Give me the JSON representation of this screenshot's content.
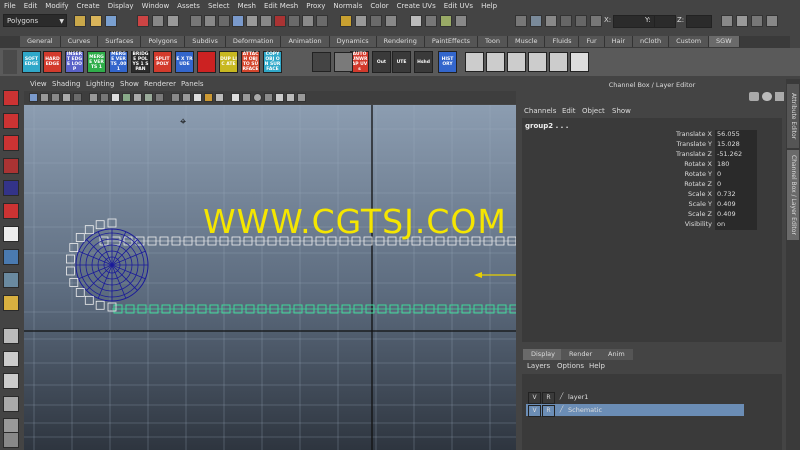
{
  "menu": [
    "File",
    "Edit",
    "Modify",
    "Create",
    "Display",
    "Window",
    "Assets",
    "Select",
    "Mesh",
    "Edit Mesh",
    "Proxy",
    "Normals",
    "Color",
    "Create UVs",
    "Edit UVs",
    "Help"
  ],
  "status": {
    "mode": "Polygons",
    "x_label": "X:",
    "y_label": "Y:",
    "z_label": "Z:"
  },
  "shelf_tabs": [
    "General",
    "Curves",
    "Surfaces",
    "Polygons",
    "Subdivs",
    "Deformation",
    "Animation",
    "Dynamics",
    "Rendering",
    "PaintEffects",
    "Toon",
    "Muscle",
    "Fluids",
    "Fur",
    "Hair",
    "nCloth",
    "Custom",
    "SGW"
  ],
  "shelf_tab_active": "SGW",
  "shelf_buttons": [
    {
      "label": "SOFT EDGE",
      "color": "#2fa8c9"
    },
    {
      "label": "HARD EDGE",
      "color": "#d33a2c"
    },
    {
      "label": "INSERT EDGE LOOP",
      "color": "#5a62c8"
    },
    {
      "label": "MERGE VERTS 1",
      "color": "#2fae4a"
    },
    {
      "label": "MERGE VERTS .001",
      "color": "#3366cc"
    },
    {
      "label": "BRIDGE POLYS 1 SPAN",
      "color": "#2b2b2b"
    },
    {
      "label": "SPLIT POLY",
      "color": "#d33a2c"
    },
    {
      "label": "E X TRUDE",
      "color": "#3366cc"
    },
    {
      "label": "",
      "color": "#cc2222"
    },
    {
      "label": "DUP LIC ATE",
      "color": "#c8b820"
    },
    {
      "label": "ATTACH OBJ TO SURFACE",
      "color": "#d3452c"
    },
    {
      "label": "COPY OBJ ON SURFACE",
      "color": "#2fa8c9"
    },
    {
      "label": "AUTO UNWRAP UVs",
      "color": "#d33a2c"
    },
    {
      "label": "Out",
      "color": "#3a3a3a"
    },
    {
      "label": "UTE",
      "color": "#3a3a3a"
    },
    {
      "label": "Hshd",
      "color": "#3a3a3a"
    },
    {
      "label": "HIST ORY",
      "color": "#3366cc"
    }
  ],
  "viewport": {
    "menu": [
      "View",
      "Shading",
      "Lighting",
      "Show",
      "Renderer",
      "Panels"
    ]
  },
  "channel_box": {
    "title": "Channel Box / Layer Editor",
    "menu": [
      "Channels",
      "Edit",
      "Object",
      "Show"
    ],
    "object": "group2 . . .",
    "attributes": [
      {
        "name": "Translate X",
        "value": "56.055"
      },
      {
        "name": "Translate Y",
        "value": "15.028"
      },
      {
        "name": "Translate Z",
        "value": "-51.262"
      },
      {
        "name": "Rotate X",
        "value": "180"
      },
      {
        "name": "Rotate Y",
        "value": "0"
      },
      {
        "name": "Rotate Z",
        "value": "0"
      },
      {
        "name": "Scale X",
        "value": "0.732"
      },
      {
        "name": "Scale Y",
        "value": "0.409"
      },
      {
        "name": "Scale Z",
        "value": "0.409"
      },
      {
        "name": "Visibility",
        "value": "on"
      }
    ]
  },
  "layer_editor": {
    "tabs": [
      "Display",
      "Render",
      "Anim"
    ],
    "menu": [
      "Layers",
      "Options",
      "Help"
    ],
    "layers": [
      {
        "v": "V",
        "r": "R",
        "name": "layer1",
        "selected": false
      },
      {
        "v": "V",
        "r": "R",
        "name": "Schematic",
        "selected": true
      }
    ]
  },
  "side_tabs": [
    "Attribute Editor",
    "Channel Box / Layer Editor"
  ],
  "watermark": "WWW.CGTSJ.COM"
}
